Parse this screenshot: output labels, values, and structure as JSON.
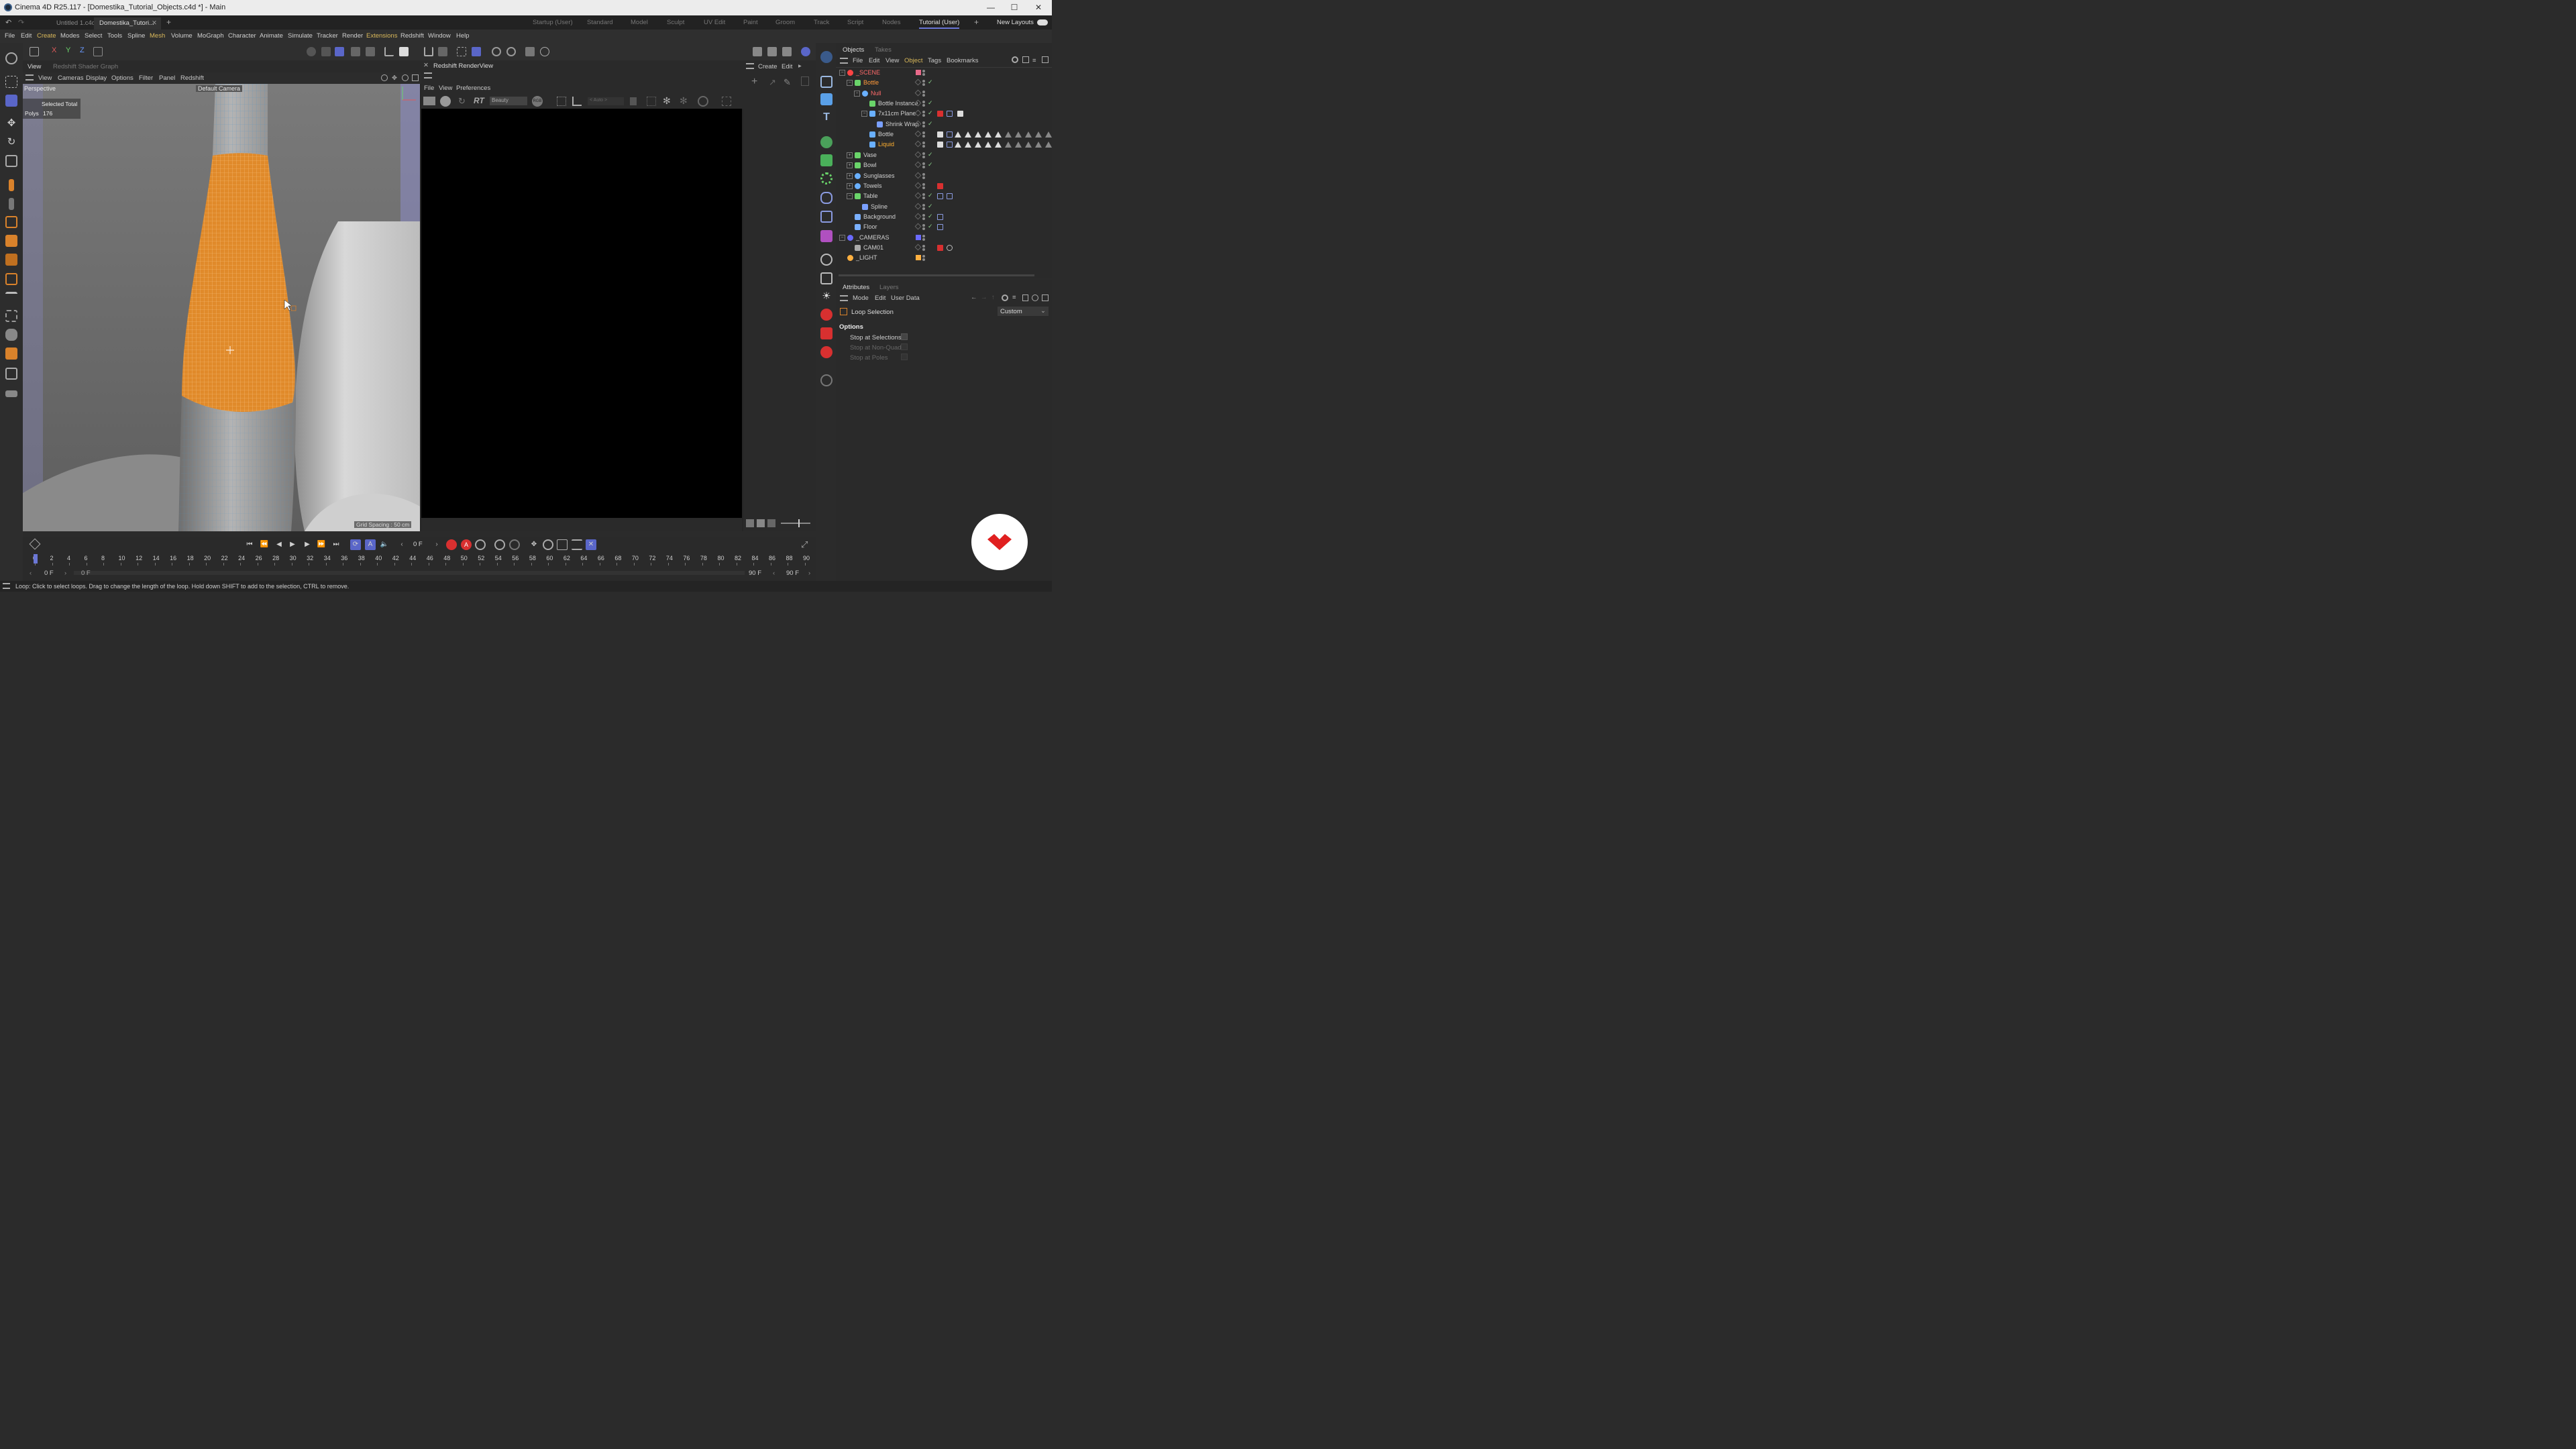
{
  "window": {
    "title": "Cinema 4D R25.117 - [Domestika_Tutorial_Objects.c4d *] - Main",
    "minimize": "—",
    "maximize": "☐",
    "close": "✕"
  },
  "doc_tabs": [
    "Untitled 1.c4d *",
    "Domestika_Tutori..."
  ],
  "doc_tab_close": "✕",
  "add_tab": "+",
  "layouts": [
    "Startup (User)",
    "Standard",
    "Model",
    "Sculpt",
    "UV Edit",
    "Paint",
    "Groom",
    "Track",
    "Script",
    "Nodes",
    "Tutorial (User)"
  ],
  "active_layout": "Tutorial (User)",
  "add_layout": "+",
  "new_layouts_label": "New Layouts",
  "menu": [
    "File",
    "Edit",
    "Create",
    "Modes",
    "Select",
    "Tools",
    "Spline",
    "Mesh",
    "Volume",
    "MoGraph",
    "Character",
    "Animate",
    "Simulate",
    "Tracker",
    "Render",
    "Extensions",
    "Redshift",
    "Window",
    "Help"
  ],
  "menu_highlighted": [
    "Create",
    "Mesh",
    "Extensions"
  ],
  "axis_buttons": [
    "X",
    "Y",
    "Z"
  ],
  "viewport": {
    "tabs": [
      "View",
      "Redshift Shader Graph"
    ],
    "menu": [
      "View",
      "Cameras",
      "Display",
      "Options",
      "Filter",
      "Panel",
      "Redshift"
    ],
    "label": "Perspective",
    "camera": "Default Camera",
    "selected_total_label": "Selected Total",
    "polys_label": "Polys",
    "polys_value": "176",
    "grid_spacing": "Grid Spacing : 50 cm"
  },
  "renderview": {
    "title": "Redshift RenderView",
    "menu": [
      "File",
      "View",
      "Preferences"
    ],
    "rt_label": "RT",
    "beauty": "Beauty",
    "rgb": "RGB",
    "auto": "< Auto >"
  },
  "rv_side_menu": [
    "Create",
    "Edit"
  ],
  "objects_panel": {
    "tabs": [
      "Objects",
      "Takes"
    ],
    "menu": [
      "File",
      "Edit",
      "View",
      "Object",
      "Tags",
      "Bookmarks"
    ],
    "active_menu": "Object",
    "rows": [
      {
        "name": "_SCENE",
        "depth": 0,
        "expander": "−",
        "icon": "null",
        "color": "#ff4444",
        "swatch": "#e86a8a",
        "check": false,
        "name_color": "#ff6a6a"
      },
      {
        "name": "Bottle",
        "depth": 1,
        "expander": "−",
        "icon": "instance",
        "color": "#6ad46a",
        "swatch": "",
        "check": true,
        "name_color": "#ff9a3a"
      },
      {
        "name": "Null",
        "depth": 2,
        "expander": "−",
        "icon": "null",
        "color": "#6ab0ff",
        "swatch": "",
        "check": false,
        "name_color": "#ff6a6a"
      },
      {
        "name": "Bottle Instance",
        "depth": 3,
        "expander": "",
        "icon": "instance",
        "color": "#6ad46a",
        "swatch": "",
        "check": true,
        "name_color": "#d0d0d0"
      },
      {
        "name": "7x11cm Plane",
        "depth": 3,
        "expander": "−",
        "icon": "poly",
        "color": "#6ab0ff",
        "swatch": "",
        "check": true,
        "name_color": "#d0d0d0"
      },
      {
        "name": "Shrink Wrap",
        "depth": 4,
        "expander": "",
        "icon": "deform",
        "color": "#7aa0ff",
        "swatch": "",
        "check": true,
        "name_color": "#d0d0d0"
      },
      {
        "name": "Bottle",
        "depth": 3,
        "expander": "",
        "icon": "poly",
        "color": "#6ab0ff",
        "swatch": "",
        "check": false,
        "name_color": "#d0d0d0"
      },
      {
        "name": "Liquid",
        "depth": 3,
        "expander": "",
        "icon": "poly",
        "color": "#6ab0ff",
        "swatch": "",
        "check": false,
        "name_color": "#ffb030"
      },
      {
        "name": "Vase",
        "depth": 1,
        "expander": "+",
        "icon": "instance",
        "color": "#6ad46a",
        "swatch": "",
        "check": true,
        "name_color": "#d0d0d0"
      },
      {
        "name": "Bowl",
        "depth": 1,
        "expander": "+",
        "icon": "instance",
        "color": "#6ad46a",
        "swatch": "",
        "check": true,
        "name_color": "#d0d0d0"
      },
      {
        "name": "Sunglasses",
        "depth": 1,
        "expander": "+",
        "icon": "null",
        "color": "#6ab0ff",
        "swatch": "",
        "check": false,
        "name_color": "#d0d0d0"
      },
      {
        "name": "Towels",
        "depth": 1,
        "expander": "+",
        "icon": "null",
        "color": "#6ab0ff",
        "swatch": "",
        "check": false,
        "name_color": "#d0d0d0"
      },
      {
        "name": "Table",
        "depth": 1,
        "expander": "−",
        "icon": "cube",
        "color": "#6ad46a",
        "swatch": "",
        "check": true,
        "name_color": "#d0d0d0"
      },
      {
        "name": "Spline",
        "depth": 2,
        "expander": "",
        "icon": "spline",
        "color": "#7aa0ff",
        "swatch": "",
        "check": true,
        "name_color": "#d0d0d0"
      },
      {
        "name": "Background",
        "depth": 1,
        "expander": "",
        "icon": "bg",
        "color": "#7ab0ff",
        "swatch": "",
        "check": true,
        "name_color": "#d0d0d0"
      },
      {
        "name": "Floor",
        "depth": 1,
        "expander": "",
        "icon": "bg",
        "color": "#7ab0ff",
        "swatch": "",
        "check": true,
        "name_color": "#d0d0d0"
      },
      {
        "name": "_CAMERAS",
        "depth": 0,
        "expander": "−",
        "icon": "null",
        "color": "#6a6aff",
        "swatch": "#6a6aff",
        "check": false,
        "name_color": "#d0d0d0"
      },
      {
        "name": "CAM01",
        "depth": 1,
        "expander": "",
        "icon": "camera",
        "color": "#aaa",
        "swatch": "",
        "check": false,
        "name_color": "#d0d0d0"
      },
      {
        "name": "_LIGHT",
        "depth": 0,
        "expander": "",
        "icon": "light",
        "color": "#ffb040",
        "swatch": "#ffb040",
        "check": false,
        "name_color": "#d0d0d0"
      }
    ]
  },
  "attributes_panel": {
    "tabs": [
      "Attributes",
      "Layers"
    ],
    "menu": [
      "Mode",
      "Edit",
      "User Data"
    ],
    "tool_name": "Loop Selection",
    "preset": "Custom",
    "section": "Options",
    "options": [
      {
        "label": "Stop at Selections",
        "enabled": true
      },
      {
        "label": "Stop at Non-Quads",
        "enabled": false
      },
      {
        "label": "Stop at Poles",
        "enabled": false
      }
    ]
  },
  "timeline": {
    "current_frame": "0 F",
    "start_frame": "0 F",
    "start_frame_field": "0 F",
    "end_frame": "90 F",
    "end_frame_field": "90 F",
    "ticks": [
      "0",
      "2",
      "4",
      "6",
      "8",
      "10",
      "12",
      "14",
      "16",
      "18",
      "20",
      "22",
      "24",
      "26",
      "28",
      "30",
      "32",
      "34",
      "36",
      "38",
      "40",
      "42",
      "44",
      "46",
      "48",
      "50",
      "52",
      "54",
      "56",
      "58",
      "60",
      "62",
      "64",
      "66",
      "68",
      "70",
      "72",
      "74",
      "76",
      "78",
      "80",
      "82",
      "84",
      "86",
      "88",
      "90"
    ]
  },
  "status_text": "Loop: Click to select loops. Drag to change the length of the loop. Hold down SHIFT to add to the selection, CTRL to remove.",
  "colors": {
    "accent": "#6b77d6",
    "selection": "#e08a2a",
    "brand": "#e02020"
  }
}
